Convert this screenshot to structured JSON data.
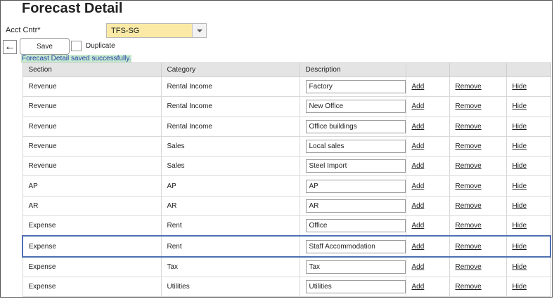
{
  "page": {
    "title": "Forecast Detail"
  },
  "form": {
    "acct_label": "Acct Cntr*",
    "acct_value": "TFS-SG",
    "save_label": "Save",
    "back_icon": "←",
    "duplicate_label": "Duplicate",
    "message": "Forecast Detail saved successfully."
  },
  "table": {
    "headers": {
      "section": "Section",
      "category": "Category",
      "description": "Description"
    },
    "actions": {
      "add": "Add",
      "remove": "Remove",
      "hide": "Hide"
    },
    "selected_row": 8,
    "rows": [
      {
        "section": "Revenue",
        "category": "Rental Income",
        "description": "Factory"
      },
      {
        "section": "Revenue",
        "category": "Rental Income",
        "description": "New Office"
      },
      {
        "section": "Revenue",
        "category": "Rental Income",
        "description": "Office buildings"
      },
      {
        "section": "Revenue",
        "category": "Sales",
        "description": "Local sales"
      },
      {
        "section": "Revenue",
        "category": "Sales",
        "description": "Steel Import"
      },
      {
        "section": "AP",
        "category": "AP",
        "description": "AP"
      },
      {
        "section": "AR",
        "category": "AR",
        "description": "AR"
      },
      {
        "section": "Expense",
        "category": "Rent",
        "description": "Office"
      },
      {
        "section": "Expense",
        "category": "Rent",
        "description": "Staff Accommodation"
      },
      {
        "section": "Expense",
        "category": "Tax",
        "description": "Tax"
      },
      {
        "section": "Expense",
        "category": "Utilities",
        "description": "Utilities"
      }
    ]
  }
}
